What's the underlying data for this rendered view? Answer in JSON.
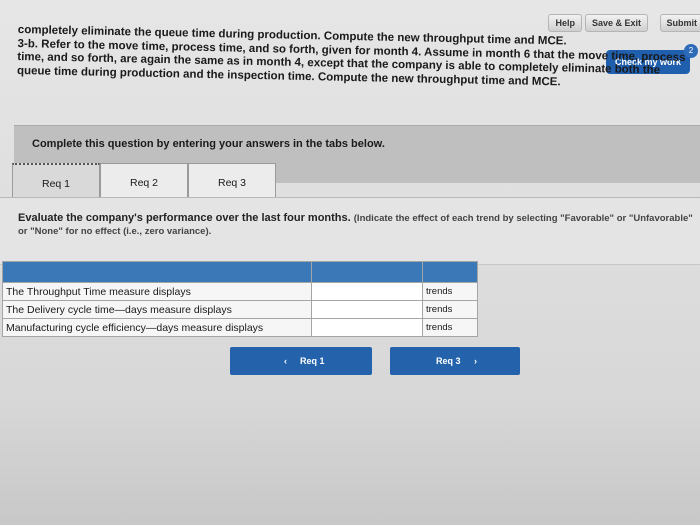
{
  "toolbar": {
    "help_label": "Help",
    "save_exit_label": "Save & Exit",
    "submit_label": "Submit",
    "check_label": "Check my work",
    "check_badge": "2"
  },
  "instructions": {
    "line1": "completely eliminate the queue time during production. Compute the new throughput time and MCE.",
    "line2": "3-b. Refer to the move time, process time, and so forth, given for month 4. Assume in month 6 that the move time, process",
    "line3": "time, and so forth, are again the same as in month 4, except that the company is able to completely eliminate both the",
    "line4": "queue time during production and the inspection time. Compute the new throughput time and MCE."
  },
  "complete_heading": "Complete this question by entering your answers in the tabs below.",
  "tabs": [
    {
      "label": "Req 1"
    },
    {
      "label": "Req 2"
    },
    {
      "label": "Req 3"
    }
  ],
  "question": {
    "text": "Evaluate the company's performance over the last four months.",
    "hint": "(Indicate the effect of each trend by selecting \"Favorable\" or \"Unfavorable\" or \"None\" for no effect (i.e., zero variance)."
  },
  "answer_table": {
    "rows": [
      {
        "label": "The Throughput Time measure displays",
        "value": "",
        "suffix": "trends"
      },
      {
        "label": "The Delivery cycle time—days measure displays",
        "value": "",
        "suffix": "trends"
      },
      {
        "label": "Manufacturing cycle efficiency—days measure displays",
        "value": "",
        "suffix": "trends"
      }
    ]
  },
  "nav": {
    "prev_label": "Req 1",
    "prev_arrow": "‹",
    "next_label": "Req 3",
    "next_arrow": "›"
  }
}
